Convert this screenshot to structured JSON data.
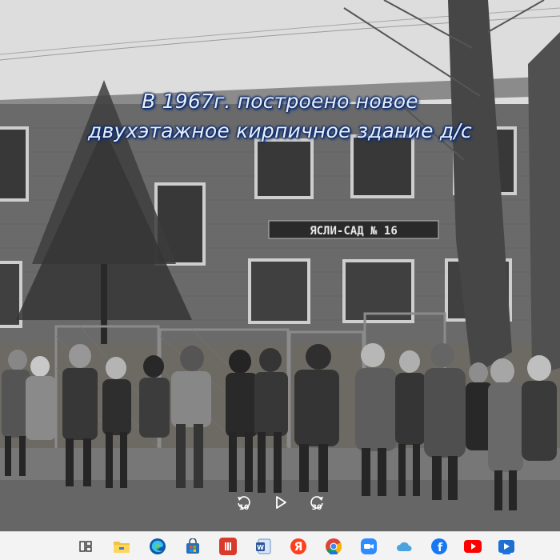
{
  "slide": {
    "caption_line1": "В 1967г. построено новое",
    "caption_line2": "двухэтажное кирпичное здание д/с",
    "sign_text": "ЯСЛИ-САД № 16"
  },
  "media_controls": {
    "rewind_seconds": "10",
    "forward_seconds": "30"
  },
  "taskbar": {
    "icons": [
      "task-view-icon",
      "file-explorer-icon",
      "edge-icon",
      "store-icon",
      "app-red-icon",
      "word-icon",
      "yandex-icon",
      "chrome-icon",
      "zoom-icon",
      "cloud-icon",
      "facebook-icon",
      "youtube-icon",
      "video-player-icon"
    ],
    "colors": {
      "yandex": "#fc3f1d",
      "facebook": "#1877f2",
      "youtube": "#ff0000",
      "chrome_red": "#db4437",
      "edge_blue": "#0c59a4",
      "zoom": "#2d8cff"
    }
  }
}
